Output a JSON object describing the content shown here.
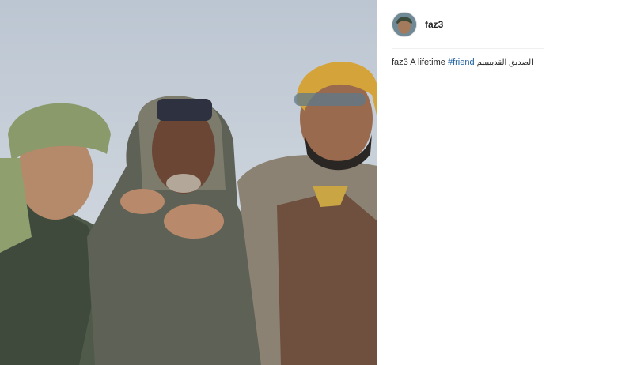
{
  "post": {
    "image_alt": "",
    "author": {
      "username": "faz3"
    },
    "caption": {
      "username": "faz3",
      "text_before": "A lifetime",
      "hashtag": "#friend",
      "arabic_text": "الصديق القديييييم"
    }
  },
  "colors": {
    "hashtag": "#1b5f9e",
    "text": "#262626",
    "divider": "#efefef"
  }
}
